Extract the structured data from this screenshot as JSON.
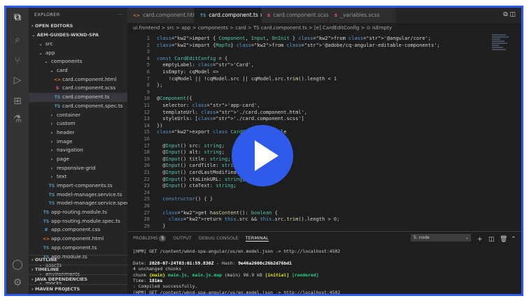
{
  "colors": {
    "accent": "#2f5bea",
    "editor_bg": "#1e1e1e",
    "sidebar_bg": "#252526"
  },
  "activity_icons": [
    "files-icon",
    "search-icon",
    "source-control-icon",
    "run-debug-icon",
    "extensions-icon",
    "test-icon",
    "account-icon",
    "settings-gear-icon"
  ],
  "sidebar": {
    "title": "EXPLORER",
    "more": "···",
    "open_editors": "OPEN EDITORS",
    "project": "AEM-GUIDES-WKND-SPA",
    "tree": [
      {
        "label": "src",
        "indent": 2,
        "icon": "chevron",
        "kind": "folder"
      },
      {
        "label": "app",
        "indent": 2,
        "icon": "chevron",
        "kind": "folder"
      },
      {
        "label": "components",
        "indent": 3,
        "icon": "chevron",
        "kind": "folder"
      },
      {
        "label": "card",
        "indent": 4,
        "icon": "chevron",
        "kind": "folder"
      },
      {
        "label": "card.component.html",
        "indent": 5,
        "icon": "<>",
        "kind": "html"
      },
      {
        "label": "card.component.scss",
        "indent": 5,
        "icon": "S",
        "kind": "scss"
      },
      {
        "label": "card.component.ts",
        "indent": 5,
        "icon": "TS",
        "kind": "ts",
        "selected": true
      },
      {
        "label": "card.component.spec.ts",
        "indent": 5,
        "icon": "TS",
        "kind": "ts"
      },
      {
        "label": "container",
        "indent": 4,
        "icon": ">",
        "kind": "folder"
      },
      {
        "label": "custom",
        "indent": 4,
        "icon": ">",
        "kind": "folder"
      },
      {
        "label": "header",
        "indent": 4,
        "icon": ">",
        "kind": "folder"
      },
      {
        "label": "image",
        "indent": 4,
        "icon": ">",
        "kind": "folder"
      },
      {
        "label": "navigation",
        "indent": 4,
        "icon": ">",
        "kind": "folder"
      },
      {
        "label": "page",
        "indent": 4,
        "icon": ">",
        "kind": "folder"
      },
      {
        "label": "responsive-grid",
        "indent": 4,
        "icon": ">",
        "kind": "folder"
      },
      {
        "label": "text",
        "indent": 4,
        "icon": ">",
        "kind": "folder"
      },
      {
        "label": "import-components.ts",
        "indent": 4,
        "icon": "TS",
        "kind": "ts"
      },
      {
        "label": "model-manager.service.ts",
        "indent": 4,
        "icon": "TS",
        "kind": "ts"
      },
      {
        "label": "model-manager.service.spec.ts",
        "indent": 4,
        "icon": "TS",
        "kind": "ts"
      },
      {
        "label": "app-routing.module.ts",
        "indent": 3,
        "icon": "TS",
        "kind": "ts"
      },
      {
        "label": "app-routing.module.spec.ts",
        "indent": 3,
        "icon": "TS",
        "kind": "ts"
      },
      {
        "label": "app.component.css",
        "indent": 3,
        "icon": "#",
        "kind": "css"
      },
      {
        "label": "app.component.html",
        "indent": 3,
        "icon": "<>",
        "kind": "html"
      },
      {
        "label": "app.component.ts",
        "indent": 3,
        "icon": "TS",
        "kind": "ts"
      },
      {
        "label": "app.module.ts",
        "indent": 3,
        "icon": "TS",
        "kind": "ts"
      },
      {
        "label": "assets",
        "indent": 2,
        "icon": ">",
        "kind": "folder"
      },
      {
        "label": "environments",
        "indent": 2,
        "icon": ">",
        "kind": "folder"
      },
      {
        "label": "mocks",
        "indent": 2,
        "icon": ">",
        "kind": "folder"
      }
    ],
    "bottom_sections": [
      "OUTLINE",
      "TIMELINE",
      "JAVA DEPENDENCIES",
      "MAVEN PROJECTS"
    ]
  },
  "tabs": [
    {
      "label": "card.component.html",
      "icon": "<>",
      "kind": "html"
    },
    {
      "label": "card.component.ts",
      "icon": "TS",
      "kind": "ts",
      "active": true,
      "close": "×"
    },
    {
      "label": "card.component.scss",
      "icon": "S",
      "kind": "scss"
    },
    {
      "label": "_variables.scss",
      "icon": "S",
      "kind": "scss"
    }
  ],
  "breadcrumb": "ui.frontend > src > app > components > card > TS card.component.ts > [e] CardEditConfig > ⊙ isEmpty",
  "code_lines": [
    {
      "n": "1",
      "t": "import { Component, Input, OnInit } from '@angular/core';"
    },
    {
      "n": "2",
      "t": "import {MapTo} from '@adobe/cq-angular-editable-components';"
    },
    {
      "n": "3",
      "t": ""
    },
    {
      "n": "4",
      "t": "const CardEditConfig = {"
    },
    {
      "n": "5",
      "t": "  emptyLabel: 'Card',"
    },
    {
      "n": "6",
      "t": "  isEmpty: cqModel =>"
    },
    {
      "n": "7",
      "t": "    !cqModel || !cqModel.src || cqModel.src.trim().length < 1"
    },
    {
      "n": "8",
      "t": "};"
    },
    {
      "n": "9",
      "t": ""
    },
    {
      "n": "10",
      "t": "@Component({"
    },
    {
      "n": "11",
      "t": "  selector: 'app-card',"
    },
    {
      "n": "12",
      "t": "  templateUrl: './card.component.html',"
    },
    {
      "n": "13",
      "t": "  styleUrls: ['./card.component.scss']"
    },
    {
      "n": "14",
      "t": "})"
    },
    {
      "n": "15",
      "t": "export class CardComponent imple"
    },
    {
      "n": "16",
      "t": ""
    },
    {
      "n": "17",
      "t": "  @Input() src: string;"
    },
    {
      "n": "18",
      "t": "  @Input() alt: string;"
    },
    {
      "n": "19",
      "t": "  @Input() title: string;"
    },
    {
      "n": "20",
      "t": "  @Input() cardTitle: string;"
    },
    {
      "n": "21",
      "t": "  @Input() cardLastModified: numbe"
    },
    {
      "n": "22",
      "t": "  @Input() ctaLinkURL: string;"
    },
    {
      "n": "23",
      "t": "  @Input() ctaText: string;"
    },
    {
      "n": "24",
      "t": ""
    },
    {
      "n": "25",
      "t": "  constructor() { }"
    },
    {
      "n": "26",
      "t": ""
    },
    {
      "n": "27",
      "t": "  get hasContent(): boolean {"
    },
    {
      "n": "28",
      "t": "    return this.src && this.src.trim().length > 0;"
    },
    {
      "n": "29",
      "t": "  }"
    }
  ],
  "panel": {
    "tabs": [
      "PROBLEMS",
      "OUTPUT",
      "DEBUG CONSOLE",
      "TERMINAL"
    ],
    "problems_count": "5",
    "active_tab": "TERMINAL",
    "terminal_select": "5: node",
    "icons": [
      "add-terminal-icon",
      "split-terminal-icon",
      "trash-icon",
      "chevron-up-icon"
    ]
  },
  "terminal_lines": [
    "[HPM] GET /content/wknd-spa-angular/us/en.model.json -> http://localhost:4502",
    "",
    "Date: 2020-07-24T03:01:59.830Z - Hash: 9e46a2600c26b2d76bd1",
    "4 unchanged chunks",
    "chunk {main} main.js, main.js.map (main) 96.9 kB [initial] [rendered]",
    "Time: 181ms",
    ": Compiled successfully.",
    "[HPM] GET /content/wknd-spa-angular/us/en.model.json -> http://localhost:4502",
    "▯"
  ]
}
